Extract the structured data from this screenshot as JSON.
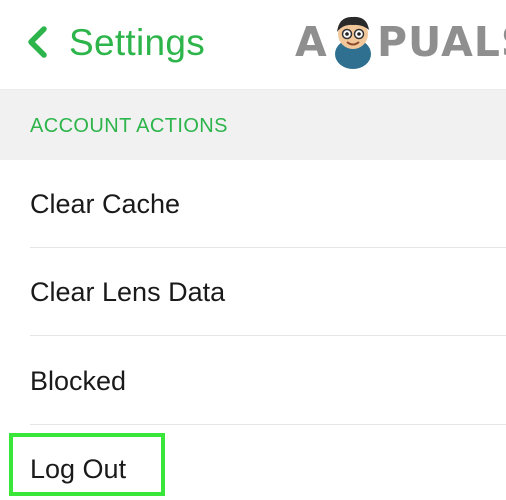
{
  "header": {
    "title": "Settings",
    "back_icon": "chevron-left-icon",
    "accent_color": "#2db54b"
  },
  "watermark": {
    "text_start": "A",
    "text_end": "PUALS"
  },
  "section": {
    "label": "ACCOUNT ACTIONS"
  },
  "items": [
    {
      "label": "Clear Cache"
    },
    {
      "label": "Clear Lens Data"
    },
    {
      "label": "Blocked"
    },
    {
      "label": "Log Out",
      "highlighted": true
    }
  ],
  "highlight_color": "#3be63b"
}
